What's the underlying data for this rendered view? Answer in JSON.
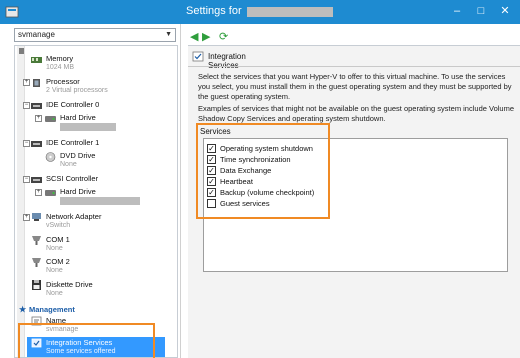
{
  "window": {
    "title": "Settings for",
    "minimize": "–",
    "maximize": "□",
    "close": "✕"
  },
  "vm_select": {
    "value": "svmanage"
  },
  "tree": {
    "items": [
      {
        "label": "Memory",
        "sub": "1024 MB"
      },
      {
        "label": "Processor",
        "sub": "2 Virtual processors"
      },
      {
        "label": "IDE Controller 0",
        "sub": ""
      },
      {
        "label": "Hard Drive",
        "sub": ""
      },
      {
        "label": "IDE Controller 1",
        "sub": ""
      },
      {
        "label": "DVD Drive",
        "sub": "None"
      },
      {
        "label": "SCSI Controller",
        "sub": ""
      },
      {
        "label": "Hard Drive",
        "sub": ""
      },
      {
        "label": "Network Adapter",
        "sub": "vSwitch"
      },
      {
        "label": "COM 1",
        "sub": "None"
      },
      {
        "label": "COM 2",
        "sub": "None"
      },
      {
        "label": "Diskette Drive",
        "sub": "None"
      }
    ],
    "section": "Management",
    "mgmt_items": [
      {
        "label": "Name",
        "sub": "svmanage"
      },
      {
        "label": "Integration Services",
        "sub": "Some services offered"
      }
    ]
  },
  "right": {
    "header": "Integration Services",
    "para1": "Select the services that you want Hyper-V to offer to this virtual machine. To use the services you select, you must install them in the guest operating system and they must be supported by the guest operating system.",
    "para2": "Examples of services that might not be available on the guest operating system include Volume Shadow Copy Services and operating system shutdown.",
    "services_label": "Services",
    "services": [
      {
        "label": "Operating system shutdown",
        "checked": "✓"
      },
      {
        "label": "Time synchronization",
        "checked": "✓"
      },
      {
        "label": "Data Exchange",
        "checked": "✓"
      },
      {
        "label": "Heartbeat",
        "checked": "✓"
      },
      {
        "label": "Backup (volume checkpoint)",
        "checked": "✓"
      },
      {
        "label": "Guest services",
        "checked": ""
      }
    ]
  },
  "colors": {
    "titlebar": "#1e8bd1",
    "highlight": "#f08a24",
    "selection": "#3399ff"
  }
}
